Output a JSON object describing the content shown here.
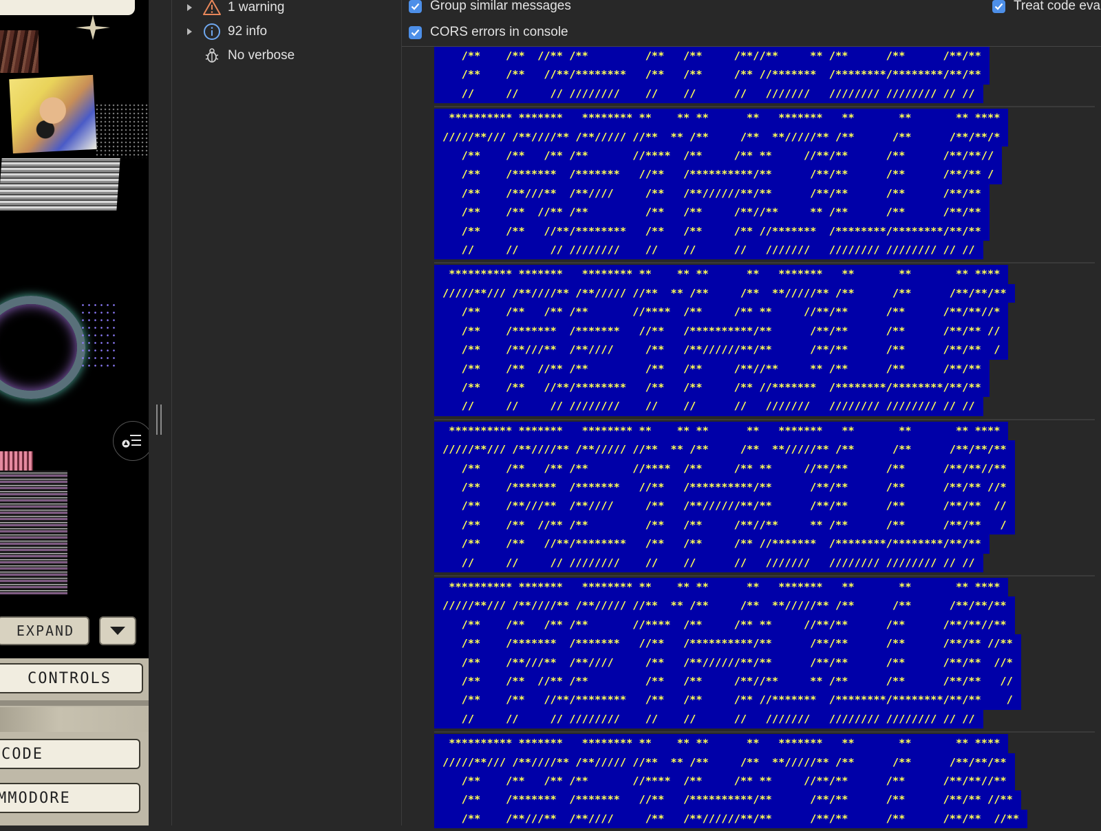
{
  "app": {
    "buttons": {
      "expand": "EXPAND",
      "controls": "CONTROLS",
      "code": "CODE",
      "commodore": "MMODORE"
    },
    "icons": [
      "sparkle-icon",
      "list-filter-icon",
      "caret-down-icon"
    ]
  },
  "sidebar": {
    "items": [
      {
        "icon": "warning-icon",
        "label": "1 warning",
        "expandable": true
      },
      {
        "icon": "info-icon",
        "label": "92 info",
        "expandable": true
      },
      {
        "icon": "bug-icon",
        "label": "No verbose",
        "expandable": false
      }
    ]
  },
  "console": {
    "options": [
      {
        "label": "Group similar messages",
        "checked": true
      },
      {
        "label": "Treat code eva",
        "checked": true
      },
      {
        "label": "CORS errors in console",
        "checked": true
      }
    ],
    "messages": [
      {
        "lines": [
          "   /**    /**  //** /**         /**   /**     /**//**     ** /**      /**      /**/**",
          "   /**    /**   //**/********   /**   /**     /** //*******  /********/********/**/**",
          "   //     //     // ////////    //    //      //   ///////   //////// //////// // //"
        ]
      },
      {
        "lines": [
          " ********** *******   ******** **    ** **      **   *******   **       **       ** ****",
          "/////**/// /**////** /**///// //**  ** /**     /**  **/////** /**      /**      /**/**/*",
          "   /**    /**   /** /**       //****  /**     /** **     //**/**      /**      /**/**//",
          "   /**    /*******  /*******   //**   /**********/**      /**/**      /**      /**/** /",
          "   /**    /**///**  /**////     /**   /**//////**/**      /**/**      /**      /**/**",
          "   /**    /**  //** /**         /**   /**     /**//**     ** /**      /**      /**/**",
          "   /**    /**   //**/********   /**   /**     /** //*******  /********/********/**/**",
          "   //     //     // ////////    //    //      //   ///////   //////// //////// // //"
        ]
      },
      {
        "lines": [
          " ********** *******   ******** **    ** **      **   *******   **       **       ** ****",
          "/////**/// /**////** /**///// //**  ** /**     /**  **/////** /**      /**      /**/**/**",
          "   /**    /**   /** /**       //****  /**     /** **     //**/**      /**      /**/**//*",
          "   /**    /*******  /*******   //**   /**********/**      /**/**      /**      /**/** //",
          "   /**    /**///**  /**////     /**   /**//////**/**      /**/**      /**      /**/**  /",
          "   /**    /**  //** /**         /**   /**     /**//**     ** /**      /**      /**/**",
          "   /**    /**   //**/********   /**   /**     /** //*******  /********/********/**/**",
          "   //     //     // ////////    //    //      //   ///////   //////// //////// // //"
        ]
      },
      {
        "lines": [
          " ********** *******   ******** **    ** **      **   *******   **       **       ** ****",
          "/////**/// /**////** /**///// //**  ** /**     /**  **/////** /**      /**      /**/**/**",
          "   /**    /**   /** /**       //****  /**     /** **     //**/**      /**      /**/**//**",
          "   /**    /*******  /*******   //**   /**********/**      /**/**      /**      /**/** //*",
          "   /**    /**///**  /**////     /**   /**//////**/**      /**/**      /**      /**/**  //",
          "   /**    /**  //** /**         /**   /**     /**//**     ** /**      /**      /**/**   /",
          "   /**    /**   //**/********   /**   /**     /** //*******  /********/********/**/**",
          "   //     //     // ////////    //    //      //   ///////   //////// //////// // //"
        ]
      },
      {
        "lines": [
          " ********** *******   ******** **    ** **      **   *******   **       **       ** ****",
          "/////**/// /**////** /**///// //**  ** /**     /**  **/////** /**      /**      /**/**/**",
          "   /**    /**   /** /**       //****  /**     /** **     //**/**      /**      /**/**//**",
          "   /**    /*******  /*******   //**   /**********/**      /**/**      /**      /**/** //**",
          "   /**    /**///**  /**////     /**   /**//////**/**      /**/**      /**      /**/**  //*",
          "   /**    /**  //** /**         /**   /**     /**//**     ** /**      /**      /**/**   //",
          "   /**    /**   //**/********   /**   /**     /** //*******  /********/********/**/**    /",
          "   //     //     // ////////    //    //      //   ///////   //////// //////// // //"
        ]
      },
      {
        "lines": [
          " ********** *******   ******** **    ** **      **   *******   **       **       ** ****",
          "/////**/// /**////** /**///// //**  ** /**     /**  **/////** /**      /**      /**/**/**",
          "   /**    /**   /** /**       //****  /**     /** **     //**/**      /**      /**/**//**",
          "   /**    /*******  /*******   //**   /**********/**      /**/**      /**      /**/** //**",
          "   /**    /**///**  /**////     /**   /**//////**/**      /**/**      /**      /**/**  //**"
        ]
      }
    ]
  }
}
